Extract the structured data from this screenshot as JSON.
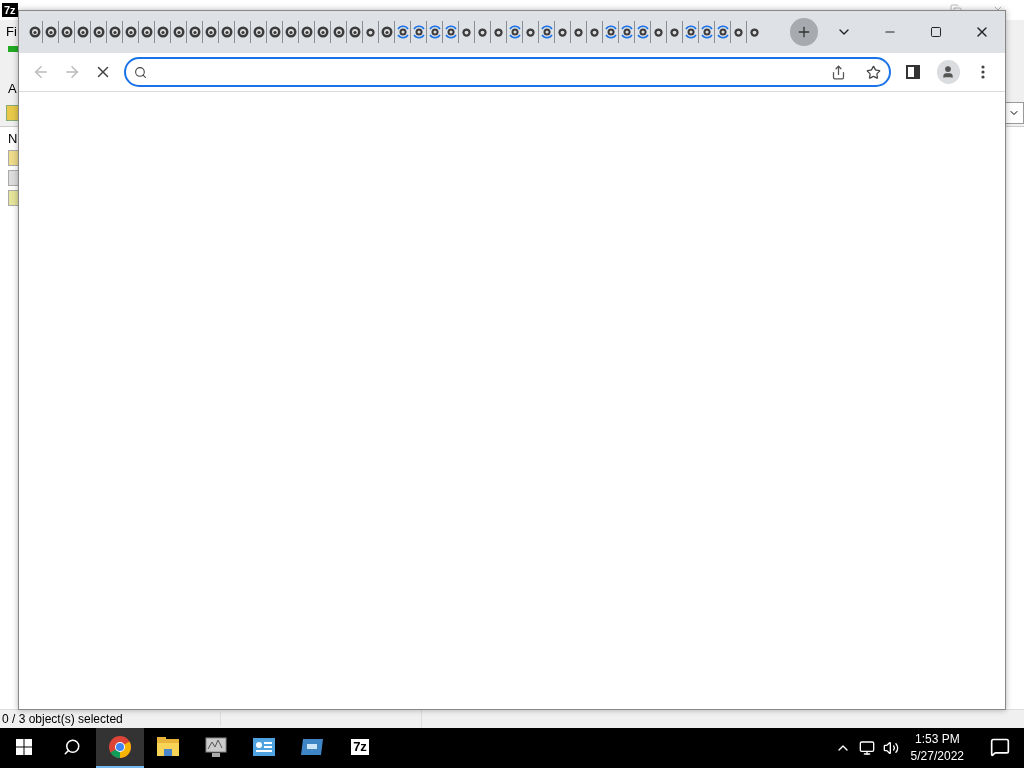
{
  "background_window": {
    "logo": "7z",
    "menu_item": "Fi",
    "toolbar_label": "A",
    "column_header": "N",
    "status_text": "0 / 3 object(s) selected"
  },
  "browser": {
    "tabs": [
      {
        "kind": "idle",
        "selected": false
      },
      {
        "kind": "idle",
        "selected": false
      },
      {
        "kind": "idle",
        "selected": false
      },
      {
        "kind": "idle",
        "selected": false
      },
      {
        "kind": "idle",
        "selected": false
      },
      {
        "kind": "idle",
        "selected": false
      },
      {
        "kind": "idle",
        "selected": false
      },
      {
        "kind": "idle",
        "selected": false
      },
      {
        "kind": "idle",
        "selected": false
      },
      {
        "kind": "idle",
        "selected": false
      },
      {
        "kind": "idle",
        "selected": false
      },
      {
        "kind": "idle",
        "selected": false
      },
      {
        "kind": "idle",
        "selected": false
      },
      {
        "kind": "idle",
        "selected": false
      },
      {
        "kind": "idle",
        "selected": false
      },
      {
        "kind": "idle",
        "selected": false
      },
      {
        "kind": "idle",
        "selected": false
      },
      {
        "kind": "idle",
        "selected": false
      },
      {
        "kind": "idle",
        "selected": false
      },
      {
        "kind": "idle",
        "selected": false
      },
      {
        "kind": "idle",
        "selected": false
      },
      {
        "kind": "small",
        "selected": false
      },
      {
        "kind": "idle",
        "selected": false
      },
      {
        "kind": "loading",
        "selected": false
      },
      {
        "kind": "loading",
        "selected": false
      },
      {
        "kind": "loading",
        "selected": false
      },
      {
        "kind": "loading",
        "selected": false
      },
      {
        "kind": "small",
        "selected": false
      },
      {
        "kind": "small",
        "selected": false
      },
      {
        "kind": "small",
        "selected": false
      },
      {
        "kind": "loading",
        "selected": false
      },
      {
        "kind": "small",
        "selected": false
      },
      {
        "kind": "loading",
        "selected": false
      },
      {
        "kind": "small",
        "selected": false
      },
      {
        "kind": "small",
        "selected": false
      },
      {
        "kind": "small",
        "selected": false
      },
      {
        "kind": "loading",
        "selected": false
      },
      {
        "kind": "loading",
        "selected": false
      },
      {
        "kind": "loading",
        "selected": false
      },
      {
        "kind": "small",
        "selected": false
      },
      {
        "kind": "small",
        "selected": false
      },
      {
        "kind": "loading",
        "selected": false
      },
      {
        "kind": "loading",
        "selected": false
      },
      {
        "kind": "loading",
        "selected": false
      },
      {
        "kind": "small",
        "selected": false
      },
      {
        "kind": "small",
        "selected": false
      }
    ],
    "address_bar": {
      "focused": true
    }
  },
  "taskbar": {
    "apps": [
      {
        "kind": "chrome",
        "selected": true
      },
      {
        "kind": "folder",
        "selected": false
      },
      {
        "kind": "monitor",
        "selected": false
      },
      {
        "kind": "panel",
        "selected": false
      },
      {
        "kind": "window",
        "selected": false
      },
      {
        "kind": "sevenzip",
        "label": "7z",
        "selected": false
      }
    ],
    "clock": {
      "time": "1:53 PM",
      "date": "5/27/2022"
    }
  }
}
